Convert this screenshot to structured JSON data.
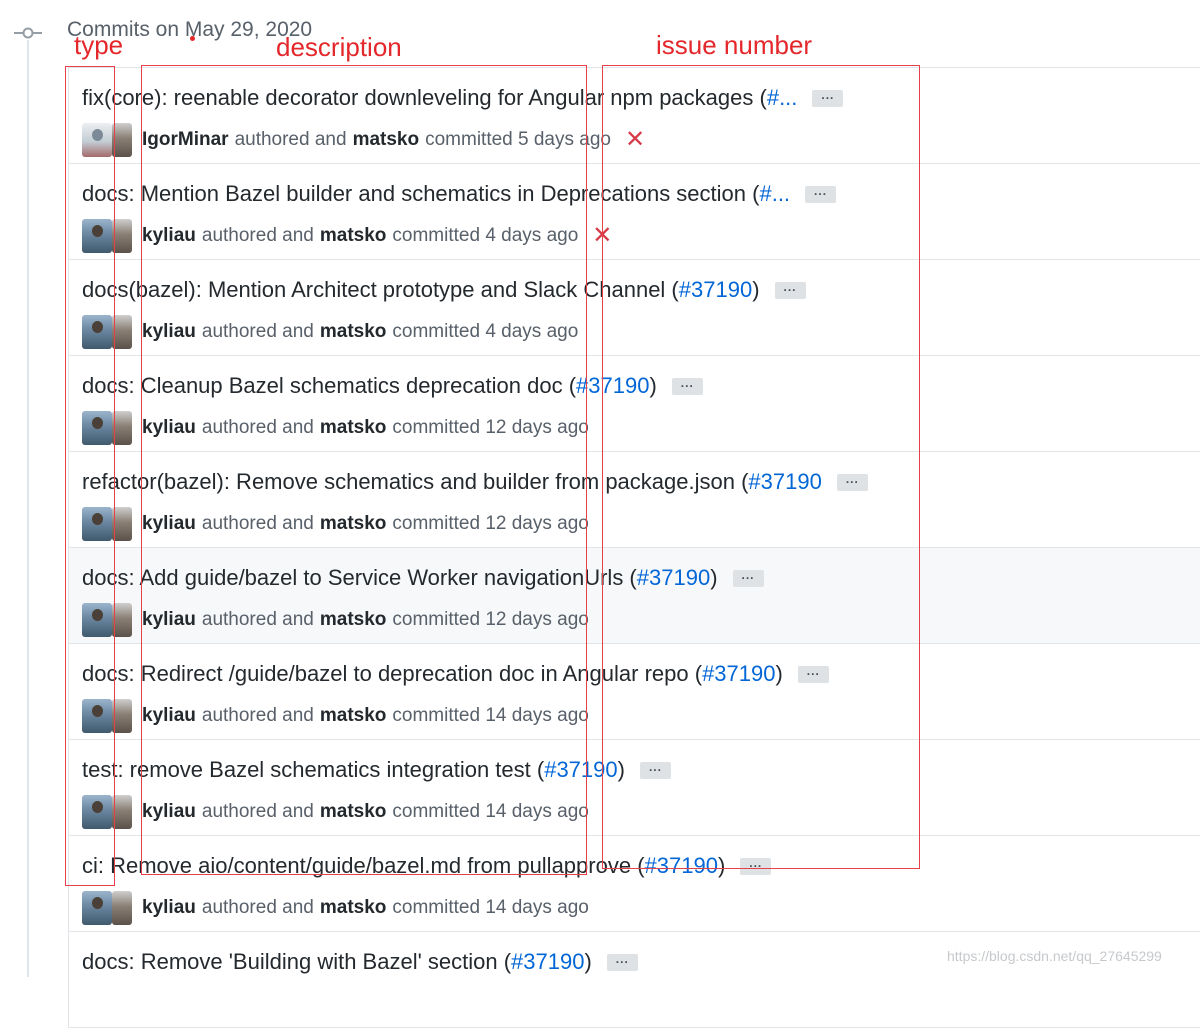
{
  "header": {
    "date_label": "Commits on May 29, 2020"
  },
  "commits": [
    {
      "message": "fix(core): reenable decorator downleveling for Angular npm packages (",
      "pr": "#...",
      "close": "",
      "ellipsis": "...",
      "author": "IgorMinar",
      "authored": "authored and",
      "committer": "matsko",
      "committed": "committed 5 days ago",
      "status": "✕"
    },
    {
      "message": "docs: Mention Bazel builder and schematics in Deprecations section (",
      "pr": "#...",
      "close": "",
      "ellipsis": "...",
      "author": "kyliau",
      "authored": "authored and",
      "committer": "matsko",
      "committed": "committed 4 days ago",
      "status": "✕"
    },
    {
      "message": "docs(bazel): Mention Architect prototype and Slack Channel (",
      "pr": "#37190",
      "close": ")",
      "ellipsis": "...",
      "author": "kyliau",
      "authored": "authored and",
      "committer": "matsko",
      "committed": "committed 4 days ago",
      "status": ""
    },
    {
      "message": "docs: Cleanup Bazel schematics deprecation doc (",
      "pr": "#37190",
      "close": ")",
      "ellipsis": "...",
      "author": "kyliau",
      "authored": "authored and",
      "committer": "matsko",
      "committed": "committed 12 days ago",
      "status": ""
    },
    {
      "message": "refactor(bazel): Remove schematics and builder from package.json (",
      "pr": "#37190",
      "close": "",
      "ellipsis": "...",
      "author": "kyliau",
      "authored": "authored and",
      "committer": "matsko",
      "committed": "committed 12 days ago",
      "status": ""
    },
    {
      "message": "docs: Add guide/bazel to Service Worker navigationUrls (",
      "pr": "#37190",
      "close": ")",
      "ellipsis": "...",
      "author": "kyliau",
      "authored": "authored and",
      "committer": "matsko",
      "committed": "committed 12 days ago",
      "status": ""
    },
    {
      "message": "docs: Redirect /guide/bazel to deprecation doc in Angular repo (",
      "pr": "#37190",
      "close": ")",
      "ellipsis": "...",
      "author": "kyliau",
      "authored": "authored and",
      "committer": "matsko",
      "committed": "committed 14 days ago",
      "status": ""
    },
    {
      "message": "test: remove Bazel schematics integration test (",
      "pr": "#37190",
      "close": ")",
      "ellipsis": "...",
      "author": "kyliau",
      "authored": "authored and",
      "committer": "matsko",
      "committed": "committed 14 days ago",
      "status": ""
    },
    {
      "message": "ci: Remove aio/content/guide/bazel.md from pullapprove (",
      "pr": "#37190",
      "close": ")",
      "ellipsis": "...",
      "author": "kyliau",
      "authored": "authored and",
      "committer": "matsko",
      "committed": "committed 14 days ago",
      "status": ""
    },
    {
      "message": "docs: Remove 'Building with Bazel' section (",
      "pr": "#37190",
      "close": ")",
      "ellipsis": "...",
      "author": "",
      "authored": "",
      "committer": "",
      "committed": "",
      "status": ""
    }
  ],
  "annotations": {
    "type_label": "type",
    "description_label": "description",
    "issue_label": "issue number",
    "color": "#e4272b"
  },
  "watermark": "https://blog.csdn.net/qq_27645299"
}
